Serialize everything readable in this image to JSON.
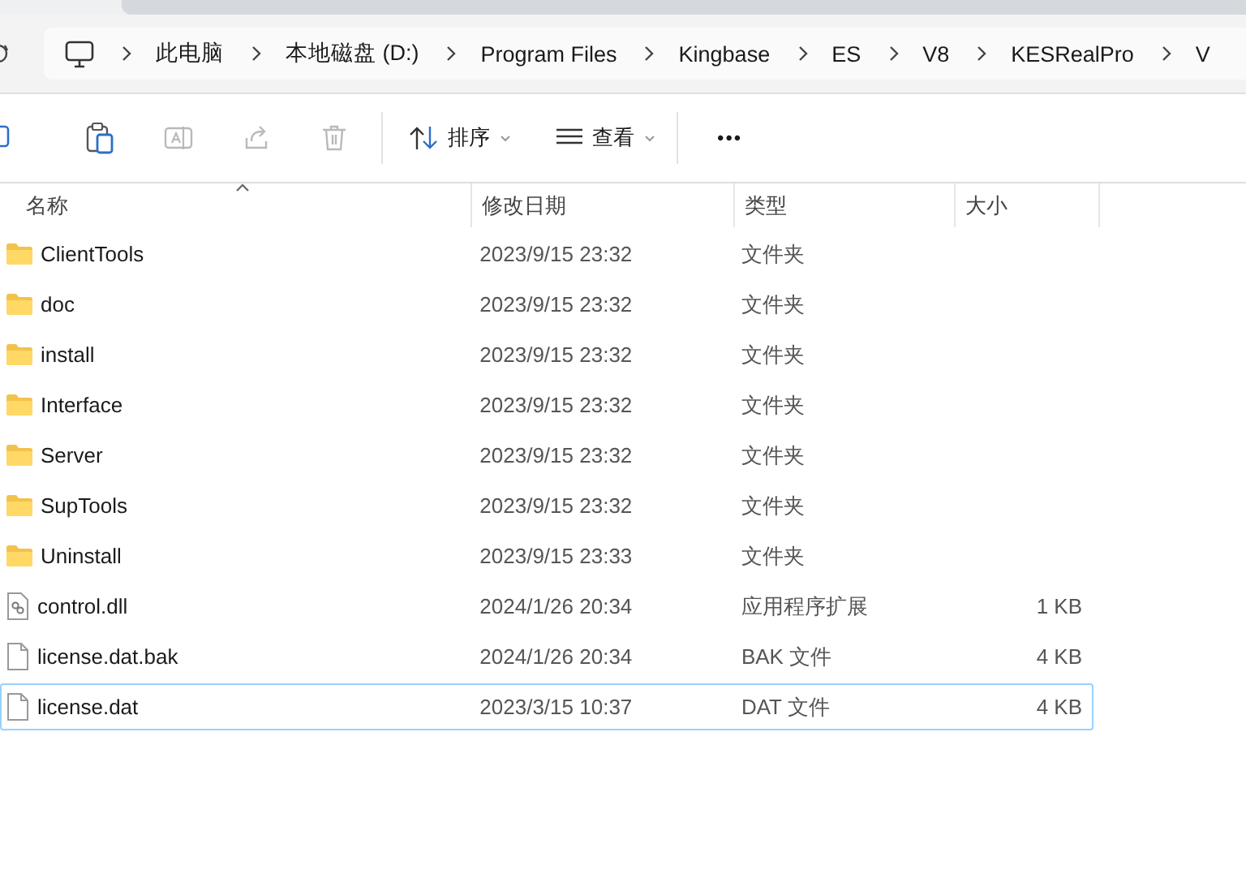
{
  "address": {
    "path": [
      "此电脑",
      "本地磁盘 (D:)",
      "Program Files",
      "Kingbase",
      "ES",
      "V8",
      "KESRealPro",
      "V"
    ]
  },
  "toolbar": {
    "icons": [
      {
        "kind": "copy",
        "disabled": false
      },
      {
        "kind": "paste",
        "disabled": false
      },
      {
        "kind": "rename",
        "disabled": true
      },
      {
        "kind": "share",
        "disabled": true
      },
      {
        "kind": "delete",
        "disabled": true
      }
    ],
    "sort": {
      "label": "排序"
    },
    "view": {
      "label": "查看"
    },
    "more": "•••"
  },
  "columns": [
    {
      "label": "名称",
      "sorted": true
    },
    {
      "label": "修改日期",
      "sorted": false
    },
    {
      "label": "类型",
      "sorted": false
    },
    {
      "label": "大小",
      "sorted": false
    }
  ],
  "rows": [
    {
      "kind": "folder",
      "name": "ClientTools",
      "date": "2023/9/15 23:32",
      "type": "文件夹",
      "selected": false
    },
    {
      "kind": "folder",
      "name": "doc",
      "date": "2023/9/15 23:32",
      "type": "文件夹",
      "selected": false
    },
    {
      "kind": "folder",
      "name": "install",
      "date": "2023/9/15 23:32",
      "type": "文件夹",
      "selected": false
    },
    {
      "kind": "folder",
      "name": "Interface",
      "date": "2023/9/15 23:32",
      "type": "文件夹",
      "selected": false
    },
    {
      "kind": "folder",
      "name": "Server",
      "date": "2023/9/15 23:32",
      "type": "文件夹",
      "selected": false
    },
    {
      "kind": "folder",
      "name": "SupTools",
      "date": "2023/9/15 23:32",
      "type": "文件夹",
      "selected": false
    },
    {
      "kind": "folder",
      "name": "Uninstall",
      "date": "2023/9/15 23:33",
      "type": "文件夹",
      "selected": false
    },
    {
      "kind": "dll",
      "name": "control.dll",
      "date": "2024/1/26 20:34",
      "type": "应用程序扩展",
      "size": "1 KB",
      "selected": false
    },
    {
      "kind": "file",
      "name": "license.dat.bak",
      "date": "2024/1/26 20:34",
      "type": "BAK 文件",
      "size": "4 KB",
      "selected": false
    },
    {
      "kind": "file",
      "name": "license.dat",
      "date": "2023/3/15 10:37",
      "type": "DAT 文件",
      "size": "4 KB",
      "selected": true
    }
  ]
}
